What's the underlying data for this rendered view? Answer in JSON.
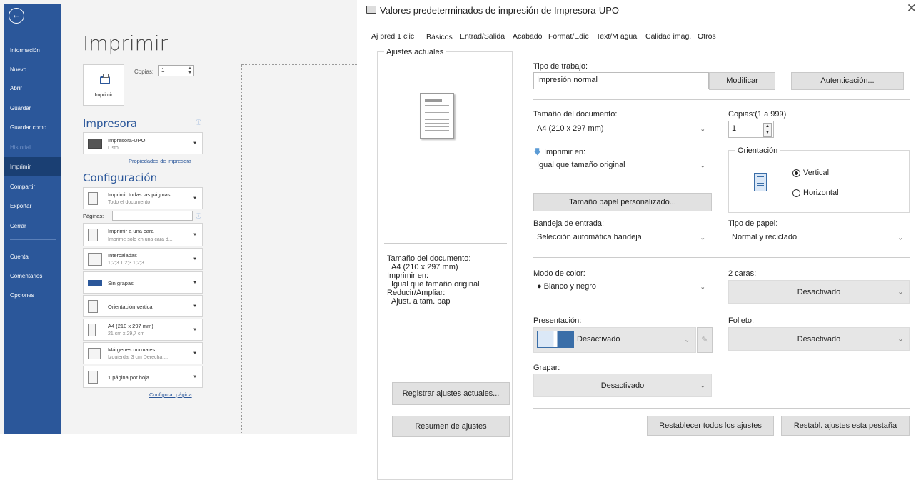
{
  "word": {
    "nav": {
      "items": [
        "Información",
        "Nuevo",
        "Abrir",
        "Guardar",
        "Guardar como",
        "Historial",
        "Imprimir",
        "Compartir",
        "Exportar",
        "Cerrar",
        "Cuenta",
        "Comentarios",
        "Opciones"
      ]
    },
    "title": "Imprimir",
    "print_button": "Imprimir",
    "copies_label": "Copias:",
    "copies_value": "1",
    "printer_section": "Impresora",
    "printer_name": "Impresora-UPO",
    "printer_status": "Listo",
    "printer_props_link": "Propiedades de impresora",
    "config_section": "Configuración",
    "pages_label": "Páginas:",
    "settings": [
      {
        "t1": "Imprimir todas las páginas",
        "t2": "Todo el documento"
      },
      {
        "t1": "Imprimir a una cara",
        "t2": "Imprime solo en una cara d..."
      },
      {
        "t1": "Intercaladas",
        "t2": "1;2;3   1;2;3   1;2;3"
      },
      {
        "t1": "Sin grapas",
        "t2": ""
      },
      {
        "t1": "Orientación vertical",
        "t2": ""
      },
      {
        "t1": "A4 (210 x 297 mm)",
        "t2": "21 cm x 29,7 cm"
      },
      {
        "t1": "Márgenes normales",
        "t2": "Izquierda: 3 cm   Derecha:..."
      },
      {
        "t1": "1 página por hoja",
        "t2": ""
      }
    ],
    "page_setup_link": "Configurar página"
  },
  "dialog": {
    "title": "Valores predeterminados de impresión de Impresora-UPO",
    "tabs": [
      "Aj pred 1 clic",
      "Básicos",
      "Entrad/Salida",
      "Acabado",
      "Format/Edic",
      "Text/M agua",
      "Calidad imag.",
      "Otros"
    ],
    "active_tab": "Básicos",
    "current_settings_label": "Ajustes actuales",
    "summary": [
      "Tamaño del documento:",
      "A4 (210 x 297 mm)",
      "Imprimir en:",
      "Igual que tamaño original",
      "Reducir/Ampliar:",
      "Ajust. a tam. pap"
    ],
    "register_button": "Registrar ajustes actuales...",
    "summary_button": "Resumen de ajustes",
    "job_type_label": "Tipo de trabajo:",
    "job_type_value": "Impresión normal",
    "modify_button": "Modificar",
    "auth_button": "Autenticación...",
    "doc_size_label": "Tamaño del documento:",
    "doc_size_value": "A4 (210 x 297 mm)",
    "copies_label": "Copias:(1 a 999)",
    "copies_value": "1",
    "print_on_label": "Imprimir en:",
    "print_on_value": "Igual que tamaño original",
    "orientation_label": "Orientación",
    "orientation_vertical": "Vertical",
    "orientation_horizontal": "Horizontal",
    "custom_paper_button": "Tamaño papel personalizado...",
    "tray_label": "Bandeja de entrada:",
    "tray_value": "Selección automática bandeja",
    "paper_type_label": "Tipo de papel:",
    "paper_type_value": "Normal y reciclado",
    "color_mode_label": "Modo de color:",
    "color_mode_value": "Blanco y negro",
    "duplex_label": "2 caras:",
    "duplex_value": "Desactivado",
    "presentation_label": "Presentación:",
    "presentation_value": "Desactivado",
    "booklet_label": "Folleto:",
    "booklet_value": "Desactivado",
    "staple_label": "Grapar:",
    "staple_value": "Desactivado",
    "reset_all_button": "Restablecer todos los ajustes",
    "reset_tab_button": "Restabl. ajustes esta pestaña"
  },
  "colors": {
    "word_nav": "#2b579a",
    "word_accent": "#2b579a"
  }
}
